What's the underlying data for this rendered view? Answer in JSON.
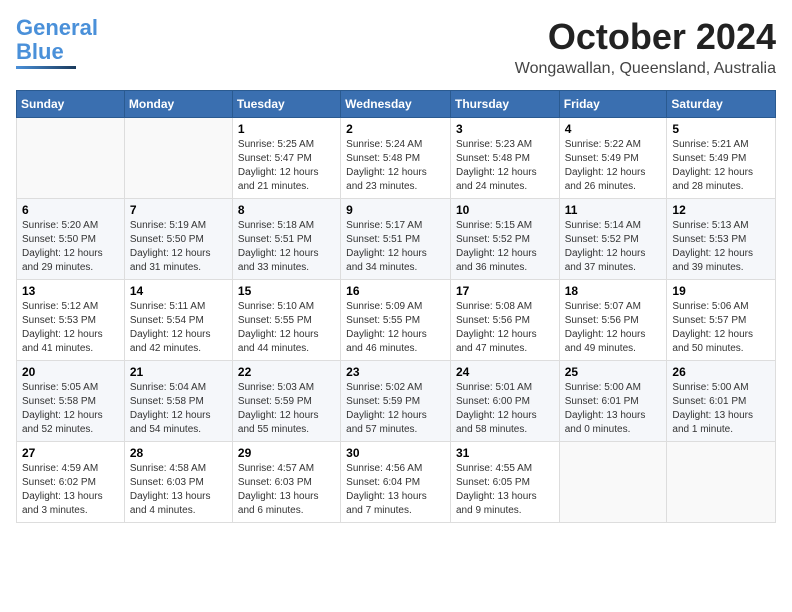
{
  "header": {
    "logo_line1": "General",
    "logo_line2": "Blue",
    "month": "October 2024",
    "location": "Wongawallan, Queensland, Australia"
  },
  "days_of_week": [
    "Sunday",
    "Monday",
    "Tuesday",
    "Wednesday",
    "Thursday",
    "Friday",
    "Saturday"
  ],
  "weeks": [
    [
      {
        "day": "",
        "sunrise": "",
        "sunset": "",
        "daylight": ""
      },
      {
        "day": "",
        "sunrise": "",
        "sunset": "",
        "daylight": ""
      },
      {
        "day": "1",
        "sunrise": "Sunrise: 5:25 AM",
        "sunset": "Sunset: 5:47 PM",
        "daylight": "Daylight: 12 hours and 21 minutes."
      },
      {
        "day": "2",
        "sunrise": "Sunrise: 5:24 AM",
        "sunset": "Sunset: 5:48 PM",
        "daylight": "Daylight: 12 hours and 23 minutes."
      },
      {
        "day": "3",
        "sunrise": "Sunrise: 5:23 AM",
        "sunset": "Sunset: 5:48 PM",
        "daylight": "Daylight: 12 hours and 24 minutes."
      },
      {
        "day": "4",
        "sunrise": "Sunrise: 5:22 AM",
        "sunset": "Sunset: 5:49 PM",
        "daylight": "Daylight: 12 hours and 26 minutes."
      },
      {
        "day": "5",
        "sunrise": "Sunrise: 5:21 AM",
        "sunset": "Sunset: 5:49 PM",
        "daylight": "Daylight: 12 hours and 28 minutes."
      }
    ],
    [
      {
        "day": "6",
        "sunrise": "Sunrise: 5:20 AM",
        "sunset": "Sunset: 5:50 PM",
        "daylight": "Daylight: 12 hours and 29 minutes."
      },
      {
        "day": "7",
        "sunrise": "Sunrise: 5:19 AM",
        "sunset": "Sunset: 5:50 PM",
        "daylight": "Daylight: 12 hours and 31 minutes."
      },
      {
        "day": "8",
        "sunrise": "Sunrise: 5:18 AM",
        "sunset": "Sunset: 5:51 PM",
        "daylight": "Daylight: 12 hours and 33 minutes."
      },
      {
        "day": "9",
        "sunrise": "Sunrise: 5:17 AM",
        "sunset": "Sunset: 5:51 PM",
        "daylight": "Daylight: 12 hours and 34 minutes."
      },
      {
        "day": "10",
        "sunrise": "Sunrise: 5:15 AM",
        "sunset": "Sunset: 5:52 PM",
        "daylight": "Daylight: 12 hours and 36 minutes."
      },
      {
        "day": "11",
        "sunrise": "Sunrise: 5:14 AM",
        "sunset": "Sunset: 5:52 PM",
        "daylight": "Daylight: 12 hours and 37 minutes."
      },
      {
        "day": "12",
        "sunrise": "Sunrise: 5:13 AM",
        "sunset": "Sunset: 5:53 PM",
        "daylight": "Daylight: 12 hours and 39 minutes."
      }
    ],
    [
      {
        "day": "13",
        "sunrise": "Sunrise: 5:12 AM",
        "sunset": "Sunset: 5:53 PM",
        "daylight": "Daylight: 12 hours and 41 minutes."
      },
      {
        "day": "14",
        "sunrise": "Sunrise: 5:11 AM",
        "sunset": "Sunset: 5:54 PM",
        "daylight": "Daylight: 12 hours and 42 minutes."
      },
      {
        "day": "15",
        "sunrise": "Sunrise: 5:10 AM",
        "sunset": "Sunset: 5:55 PM",
        "daylight": "Daylight: 12 hours and 44 minutes."
      },
      {
        "day": "16",
        "sunrise": "Sunrise: 5:09 AM",
        "sunset": "Sunset: 5:55 PM",
        "daylight": "Daylight: 12 hours and 46 minutes."
      },
      {
        "day": "17",
        "sunrise": "Sunrise: 5:08 AM",
        "sunset": "Sunset: 5:56 PM",
        "daylight": "Daylight: 12 hours and 47 minutes."
      },
      {
        "day": "18",
        "sunrise": "Sunrise: 5:07 AM",
        "sunset": "Sunset: 5:56 PM",
        "daylight": "Daylight: 12 hours and 49 minutes."
      },
      {
        "day": "19",
        "sunrise": "Sunrise: 5:06 AM",
        "sunset": "Sunset: 5:57 PM",
        "daylight": "Daylight: 12 hours and 50 minutes."
      }
    ],
    [
      {
        "day": "20",
        "sunrise": "Sunrise: 5:05 AM",
        "sunset": "Sunset: 5:58 PM",
        "daylight": "Daylight: 12 hours and 52 minutes."
      },
      {
        "day": "21",
        "sunrise": "Sunrise: 5:04 AM",
        "sunset": "Sunset: 5:58 PM",
        "daylight": "Daylight: 12 hours and 54 minutes."
      },
      {
        "day": "22",
        "sunrise": "Sunrise: 5:03 AM",
        "sunset": "Sunset: 5:59 PM",
        "daylight": "Daylight: 12 hours and 55 minutes."
      },
      {
        "day": "23",
        "sunrise": "Sunrise: 5:02 AM",
        "sunset": "Sunset: 5:59 PM",
        "daylight": "Daylight: 12 hours and 57 minutes."
      },
      {
        "day": "24",
        "sunrise": "Sunrise: 5:01 AM",
        "sunset": "Sunset: 6:00 PM",
        "daylight": "Daylight: 12 hours and 58 minutes."
      },
      {
        "day": "25",
        "sunrise": "Sunrise: 5:00 AM",
        "sunset": "Sunset: 6:01 PM",
        "daylight": "Daylight: 13 hours and 0 minutes."
      },
      {
        "day": "26",
        "sunrise": "Sunrise: 5:00 AM",
        "sunset": "Sunset: 6:01 PM",
        "daylight": "Daylight: 13 hours and 1 minute."
      }
    ],
    [
      {
        "day": "27",
        "sunrise": "Sunrise: 4:59 AM",
        "sunset": "Sunset: 6:02 PM",
        "daylight": "Daylight: 13 hours and 3 minutes."
      },
      {
        "day": "28",
        "sunrise": "Sunrise: 4:58 AM",
        "sunset": "Sunset: 6:03 PM",
        "daylight": "Daylight: 13 hours and 4 minutes."
      },
      {
        "day": "29",
        "sunrise": "Sunrise: 4:57 AM",
        "sunset": "Sunset: 6:03 PM",
        "daylight": "Daylight: 13 hours and 6 minutes."
      },
      {
        "day": "30",
        "sunrise": "Sunrise: 4:56 AM",
        "sunset": "Sunset: 6:04 PM",
        "daylight": "Daylight: 13 hours and 7 minutes."
      },
      {
        "day": "31",
        "sunrise": "Sunrise: 4:55 AM",
        "sunset": "Sunset: 6:05 PM",
        "daylight": "Daylight: 13 hours and 9 minutes."
      },
      {
        "day": "",
        "sunrise": "",
        "sunset": "",
        "daylight": ""
      },
      {
        "day": "",
        "sunrise": "",
        "sunset": "",
        "daylight": ""
      }
    ]
  ]
}
